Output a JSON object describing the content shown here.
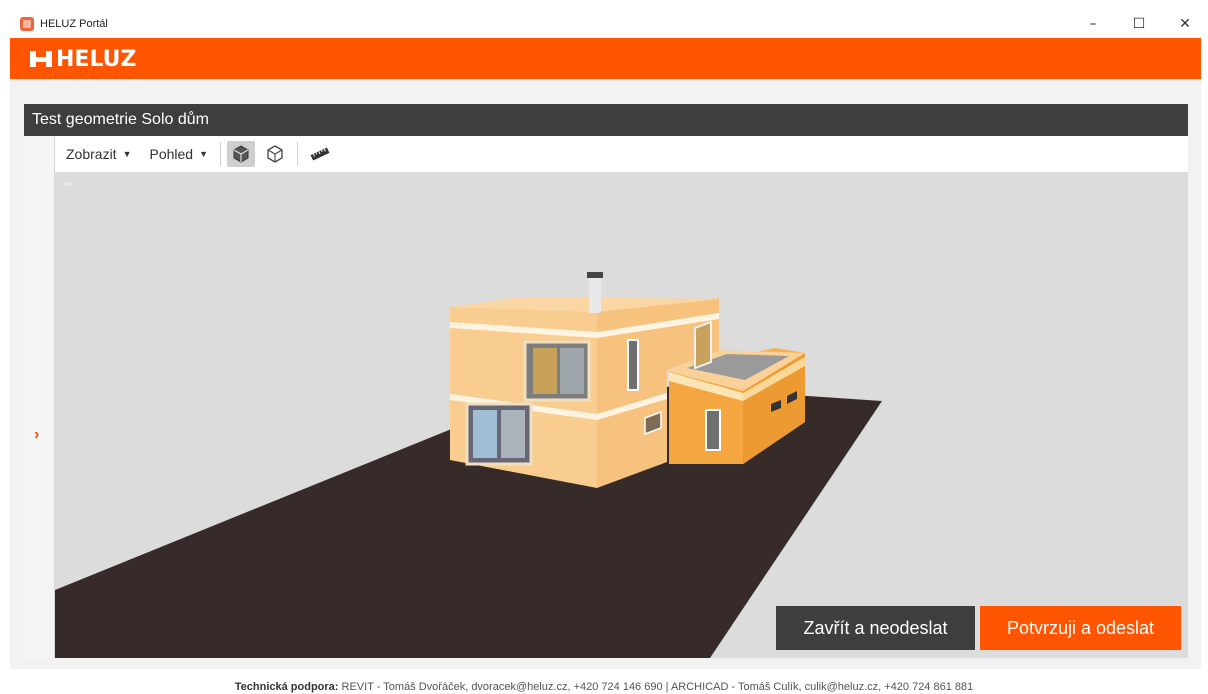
{
  "window": {
    "title": "HELUZ Portál",
    "controls": [
      "–",
      "☐",
      "✕"
    ]
  },
  "brand": {
    "logo_text": "HELUZ",
    "color": "#ff5500"
  },
  "panel": {
    "title": "Test geometrie Solo dům"
  },
  "toolbar": {
    "menu_display": "Zobrazit",
    "menu_view": "Pohled",
    "icons": [
      "solid-cube-icon",
      "wireframe-cube-icon",
      "measure-ruler-icon"
    ]
  },
  "actions": {
    "close_label": "Zavřít a neodeslat",
    "confirm_label": "Potvrzuji a odeslat"
  },
  "footer": {
    "label": "Technická podpora:",
    "text": "REVIT - Tomáš Dvořáček, dvoracek@heluz.cz, +420 724 146 690  |  ARCHICAD - Tomáš Culík, culik@heluz.cz, +420 724 861 881"
  }
}
